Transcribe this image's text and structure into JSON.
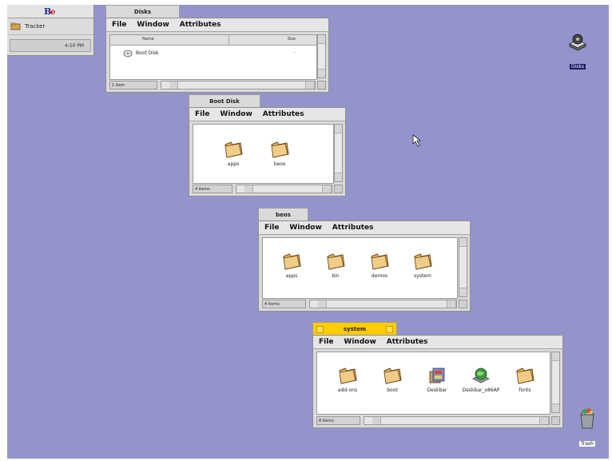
{
  "deskbar": {
    "be_label": "Be",
    "tracker_label": "Tracker",
    "time": "4:50 PM"
  },
  "windows": {
    "disks": {
      "title": "Disks",
      "menu": [
        "File",
        "Window",
        "Attributes"
      ],
      "columns": {
        "name": "Name",
        "size": "Size"
      },
      "items": [
        {
          "name": "Boot Disk",
          "size": "–"
        }
      ],
      "count": "1 item"
    },
    "bootdisk": {
      "title": "Boot Disk",
      "menu": [
        "File",
        "Window",
        "Attributes"
      ],
      "items": [
        "apps",
        "beos"
      ],
      "count": "4 items"
    },
    "beos": {
      "title": "beos",
      "menu": [
        "File",
        "Window",
        "Attributes"
      ],
      "items": [
        "apps",
        "bin",
        "demos",
        "system"
      ],
      "count": "4 items"
    },
    "system": {
      "title": "system",
      "menu": [
        "File",
        "Window",
        "Attributes"
      ],
      "items": [
        "add-ons",
        "boot",
        "Deskbar",
        "Deskbar_x86AP",
        "fonts"
      ],
      "count": "8 items"
    }
  },
  "desktop": {
    "disks_label": "Disks",
    "trash_label": "Trash"
  },
  "colors": {
    "desktop": "#9494cc",
    "active_tab": "#ffcc00",
    "inactive_tab": "#dadada"
  }
}
